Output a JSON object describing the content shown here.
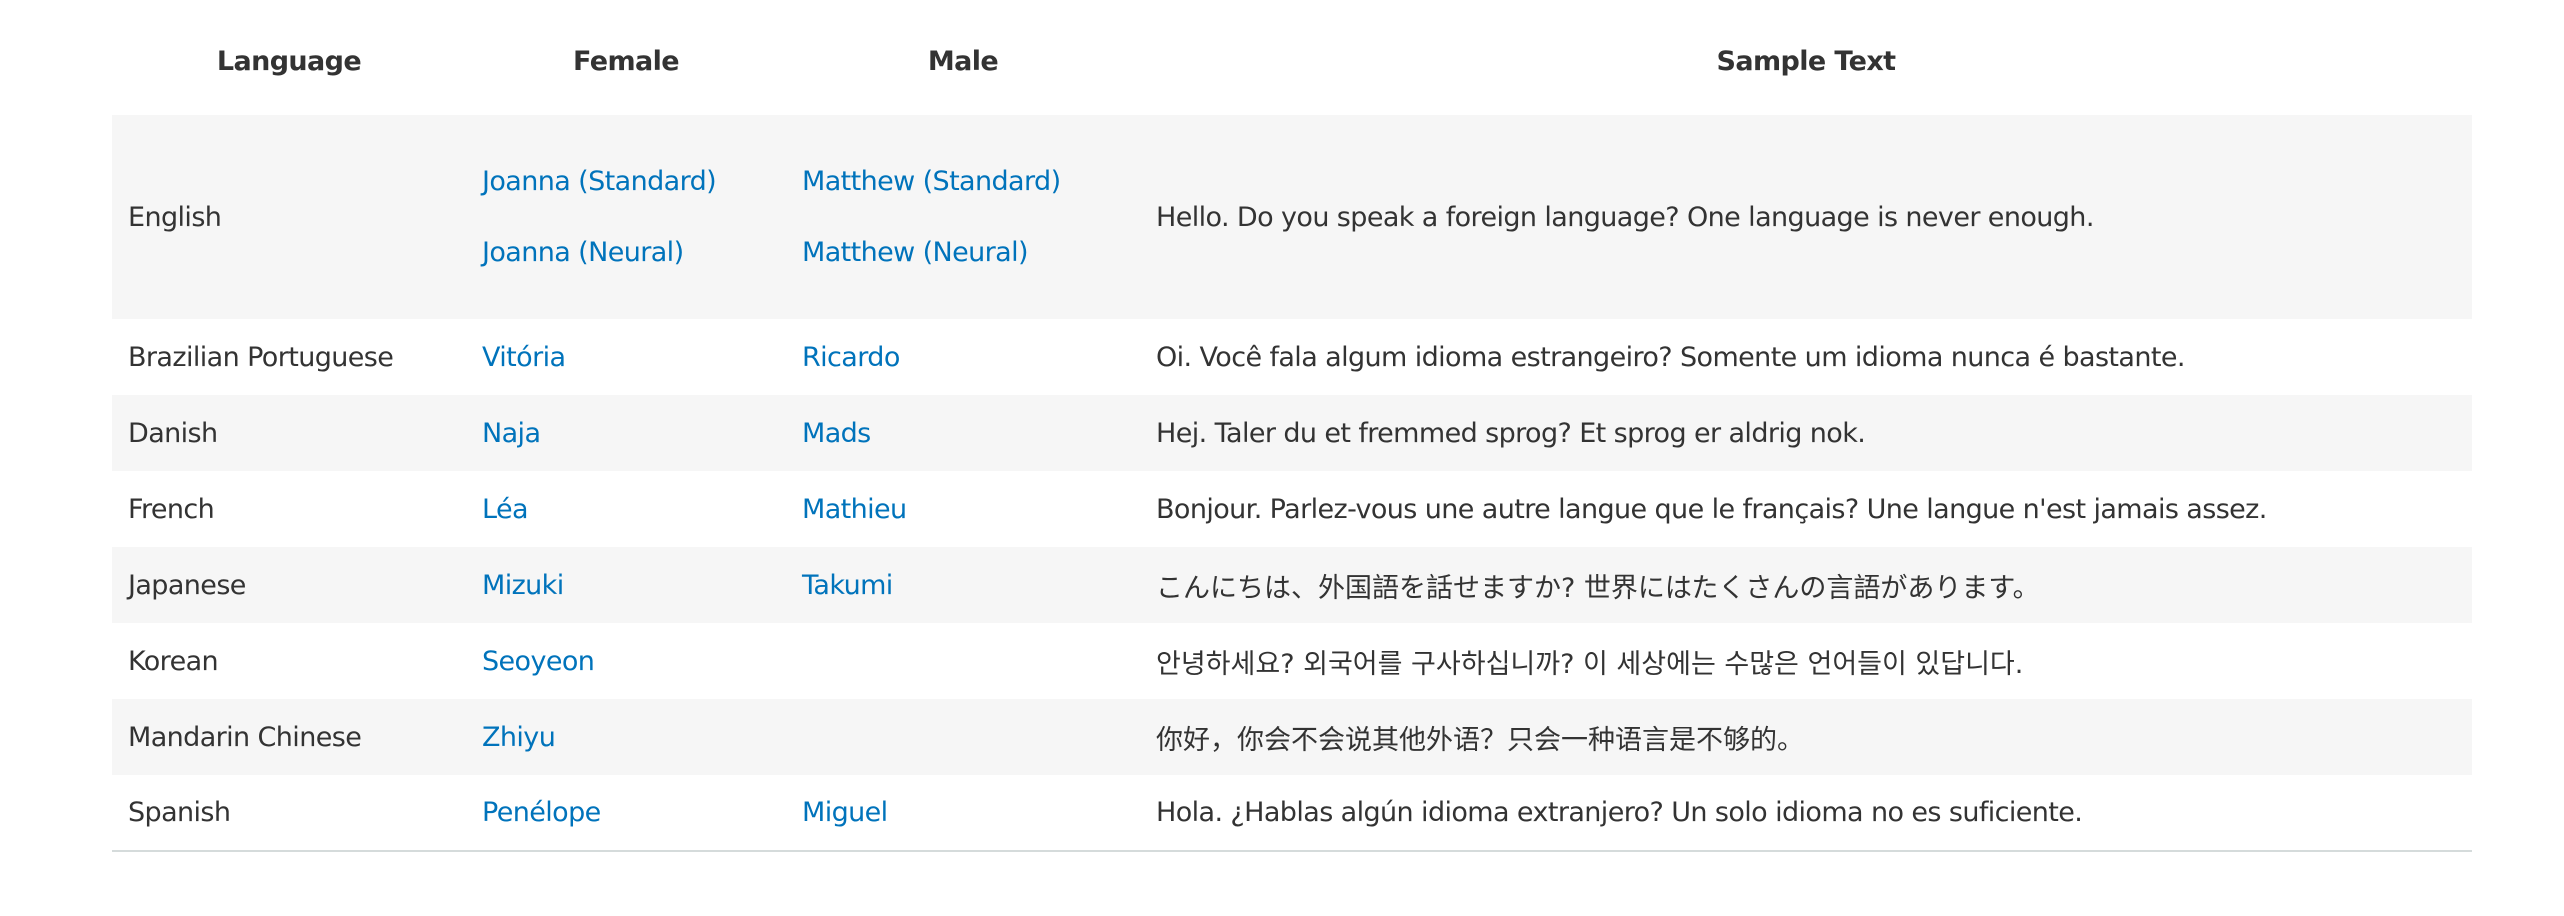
{
  "table": {
    "headers": {
      "language": "Language",
      "female": "Female",
      "male": "Male",
      "sample": "Sample Text"
    },
    "link_color": "#0073bb",
    "stripe_color": "#f6f6f6",
    "rows": [
      {
        "language": "English",
        "female": [
          "Joanna (Standard)",
          "Joanna (Neural)"
        ],
        "male": [
          "Matthew (Standard)",
          "Matthew (Neural)"
        ],
        "sample": "Hello. Do you speak a foreign language? One language is never enough."
      },
      {
        "language": "Brazilian Portuguese",
        "female": [
          "Vitória"
        ],
        "male": [
          "Ricardo"
        ],
        "sample": "Oi. Você fala algum idioma estrangeiro? Somente um idioma nunca é bastante."
      },
      {
        "language": "Danish",
        "female": [
          "Naja"
        ],
        "male": [
          "Mads"
        ],
        "sample": "Hej. Taler du et fremmed sprog? Et sprog er aldrig nok."
      },
      {
        "language": "French",
        "female": [
          "Léa"
        ],
        "male": [
          "Mathieu"
        ],
        "sample": "Bonjour. Parlez-vous une autre langue que le français? Une langue n'est jamais assez."
      },
      {
        "language": "Japanese",
        "female": [
          "Mizuki"
        ],
        "male": [
          "Takumi"
        ],
        "sample": "こんにちは、外国語を話せますか?  世界にはたくさんの言語があります。"
      },
      {
        "language": "Korean",
        "female": [
          "Seoyeon"
        ],
        "male": [],
        "sample": "안녕하세요? 외국어를 구사하십니까? 이 세상에는 수많은 언어들이 있답니다."
      },
      {
        "language": "Mandarin Chinese",
        "female": [
          "Zhiyu"
        ],
        "male": [],
        "sample": "你好，你会不会说其他外语？只会一种语言是不够的。"
      },
      {
        "language": "Spanish",
        "female": [
          "Penélope"
        ],
        "male": [
          "Miguel"
        ],
        "sample": "Hola. ¿Hablas algún idioma extranjero? Un solo idioma no es suficiente."
      }
    ]
  }
}
